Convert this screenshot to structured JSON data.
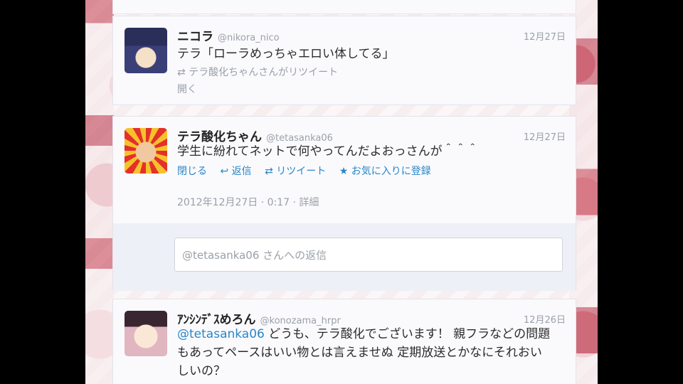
{
  "tweets": [
    {
      "name": "ニコラ",
      "handle": "@nikora_nico",
      "date": "12月27日",
      "text": "テラ「ローラめっちゃエロい体してる」",
      "retweeted_by": "テラ酸化ちゃんさんがリツイート",
      "open_label": "開く"
    },
    {
      "name": "テラ酸化ちゃん",
      "handle": "@tetasanka06",
      "date": "12月27日",
      "text": "学生に紛れてネットで何やってんだよおっさんが＾＾＾",
      "actions": {
        "close": "閉じる",
        "reply": "返信",
        "retweet": "リツイート",
        "favorite": "お気に入りに登録"
      },
      "timestamp": "2012年12月27日 · 0:17",
      "detail": "詳細",
      "reply_placeholder": "@tetasanka06 さんへの返信"
    },
    {
      "name": "ｱﾝｼﾝﾃﾞｽめろん",
      "handle": "@konozama_hrpr",
      "date": "12月26日",
      "mention": "@tetasanka06",
      "text_line1": " どうも、テラ酸化でございます！ 親フラなどの問題",
      "text_line2": "もあってペースはいい物とは言えませぬ 定期放送とかなにそれおい",
      "text_line3": "しいの？"
    }
  ],
  "icons": {
    "reply": "↩",
    "retweet": "⇄",
    "favorite": "★",
    "retweet_small": "⇄"
  }
}
